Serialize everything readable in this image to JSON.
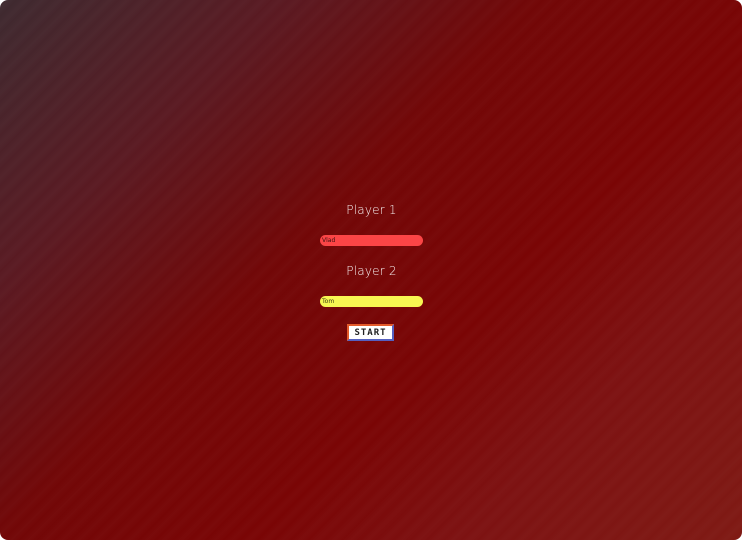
{
  "players": {
    "player1": {
      "label": "Player 1",
      "name_value": "Vlad",
      "field_color": "#fb4546"
    },
    "player2": {
      "label": "Player 2",
      "name_value": "Tom",
      "field_color": "#f7f652"
    }
  },
  "start_button": {
    "label": "START"
  }
}
